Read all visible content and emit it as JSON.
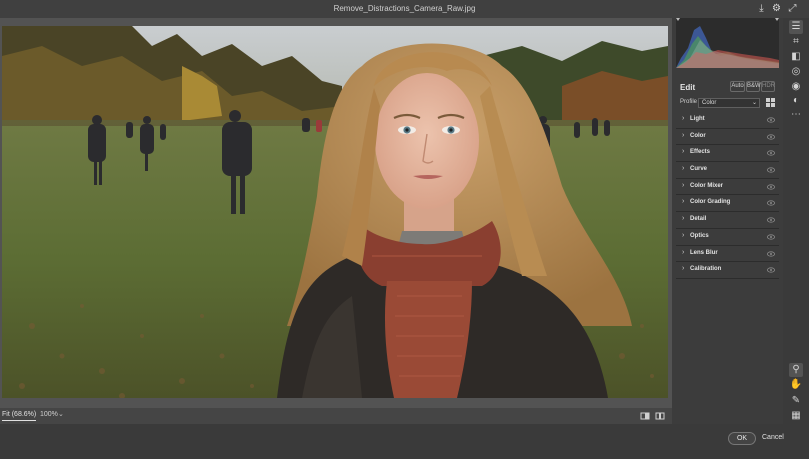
{
  "window": {
    "title": "Remove_Distractions_Camera_Raw.jpg",
    "header_icons": [
      "save-icon",
      "settings-gear-icon",
      "expand-icon"
    ]
  },
  "view": {
    "fit_label": "Fit (68.6%)",
    "zoom_label": "100%",
    "zoom_caret": "⌄"
  },
  "panel": {
    "edit_label": "Edit",
    "auto_label": "Auto",
    "bw_label": "B&W",
    "hdr_label": "HDR",
    "profile_label": "Profile",
    "profile_value": "Color",
    "profile_caret": "⌄",
    "sections": [
      {
        "label": "Light"
      },
      {
        "label": "Color"
      },
      {
        "label": "Effects"
      },
      {
        "label": "Curve"
      },
      {
        "label": "Color Mixer"
      },
      {
        "label": "Color Grading"
      },
      {
        "label": "Detail"
      },
      {
        "label": "Optics"
      },
      {
        "label": "Lens Blur"
      },
      {
        "label": "Calibration"
      }
    ]
  },
  "tools": {
    "top": [
      "edit-sliders-icon",
      "crop-icon",
      "eraser-icon",
      "mask-icon",
      "red-eye-icon",
      "presets-icon",
      "more-icon"
    ],
    "bottom": [
      "zoom-icon",
      "hand-icon",
      "color-sampler-icon",
      "grid-overlay-icon"
    ]
  },
  "footer": {
    "ok_label": "OK",
    "cancel_label": "Cancel"
  },
  "colors": {
    "background": "#535353",
    "panel": "#3c3c3c",
    "grass": "#5c6d34",
    "scarf": "#8a3f30"
  }
}
